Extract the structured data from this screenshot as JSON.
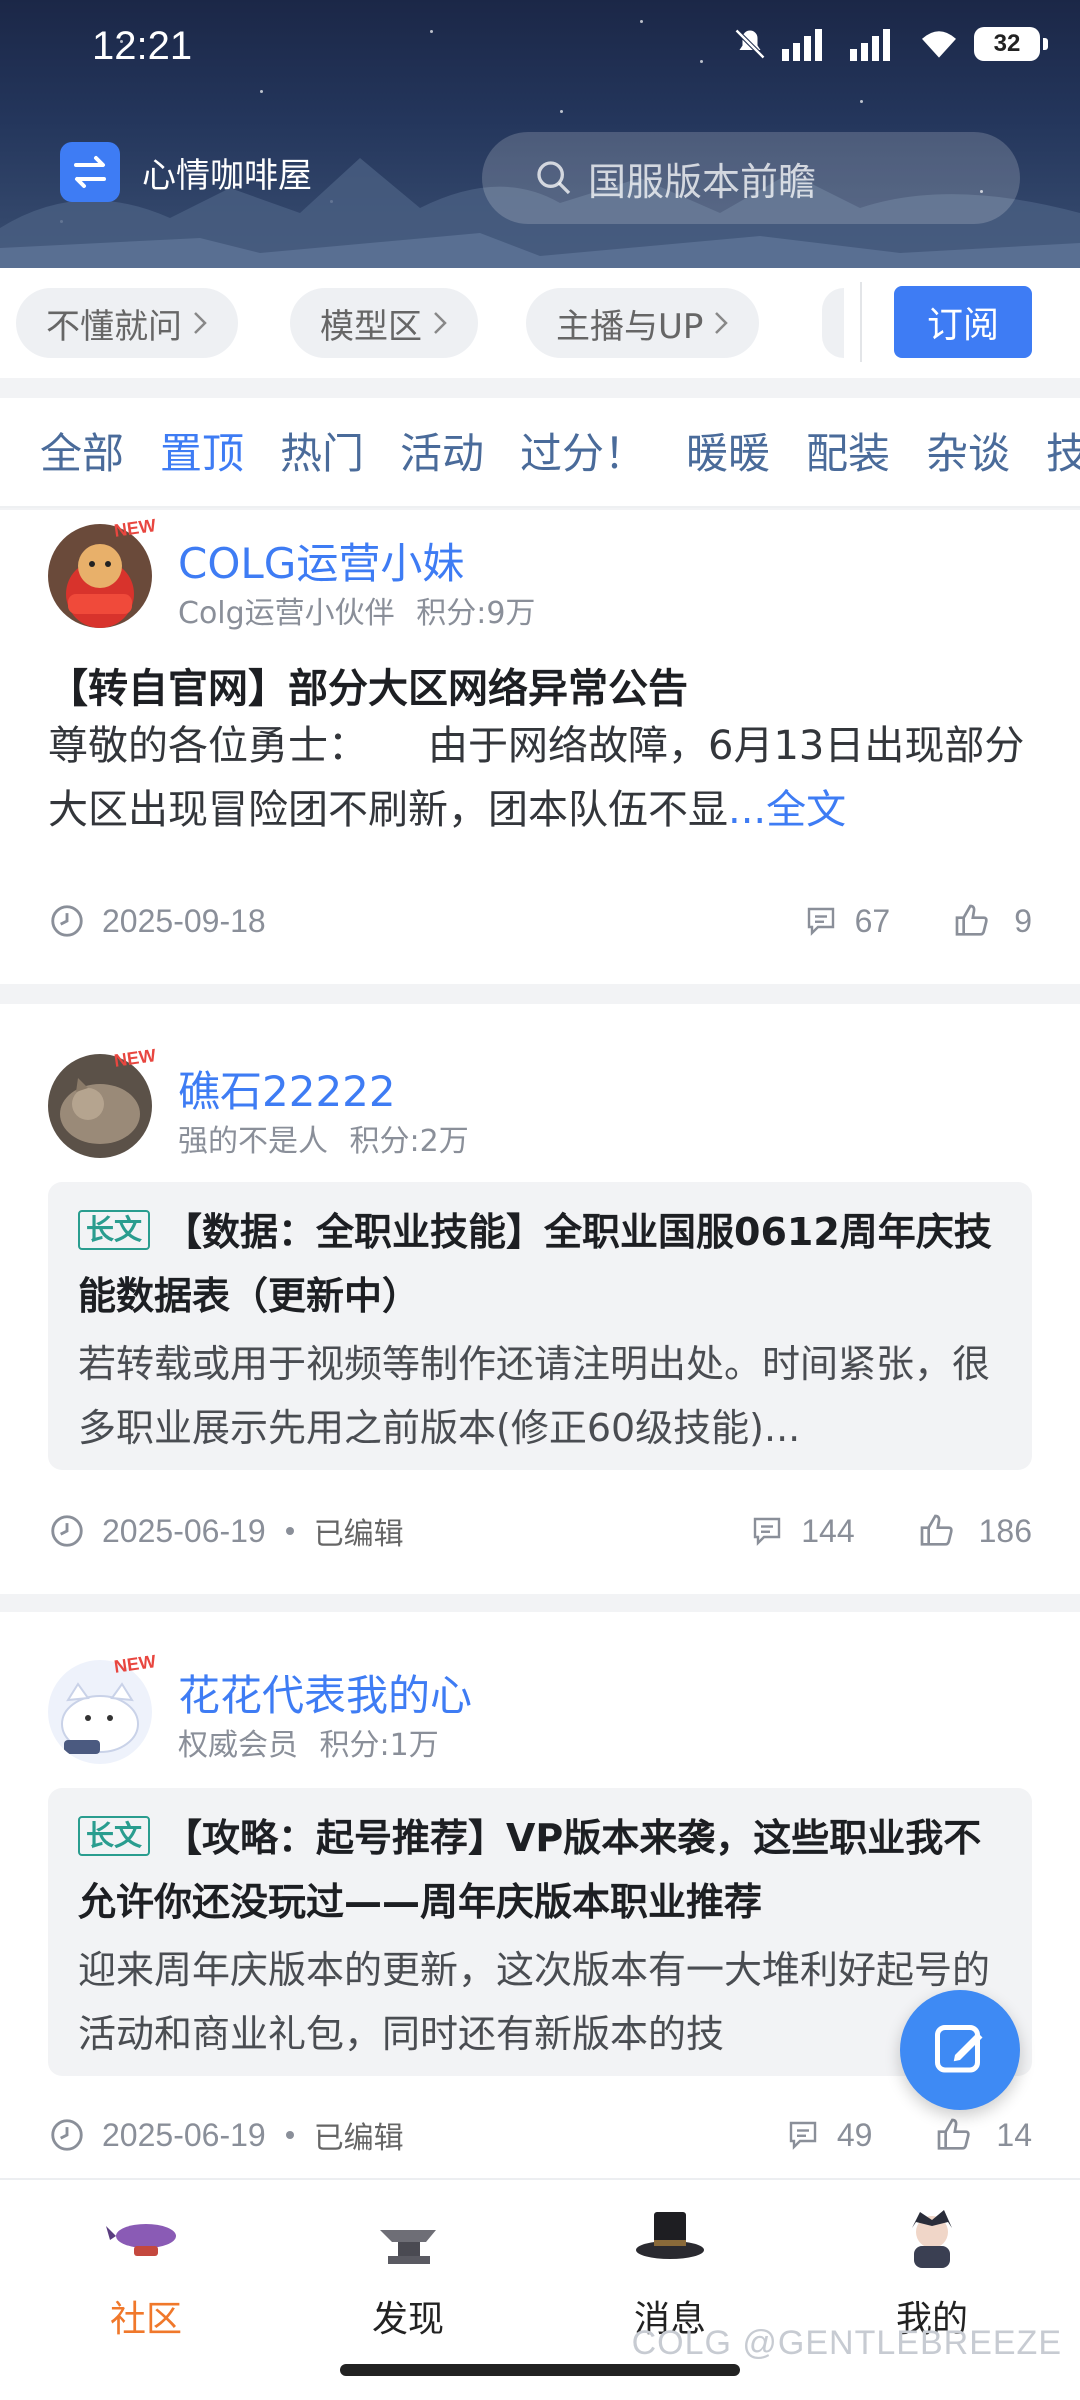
{
  "status_bar": {
    "time": "12:21",
    "battery": "32"
  },
  "header": {
    "forum_name": "心情咖啡屋",
    "search_placeholder": "国服版本前瞻"
  },
  "subforums": {
    "chips": [
      "不懂就问",
      "模型区",
      "主播与UP"
    ],
    "subscribe_label": "订阅"
  },
  "filter_tabs": [
    "全部",
    "置顶",
    "热门",
    "活动",
    "过分！",
    "暖暖",
    "配装",
    "杂谈",
    "技"
  ],
  "active_filter_tab": "置顶",
  "posts": [
    {
      "author": "COLG运营小妹",
      "new_tag": "NEW",
      "role": "Colg运营小伙伴",
      "points": "积分:9万",
      "title": "【转自官网】部分大区网络异常公告",
      "excerpt": "尊敬的各位勇士：　　由于网络故障，6月13日出现部分大区出现冒险团不刷新，团本队伍不显",
      "more_label": "...全文",
      "date": "2025-09-18",
      "edited": "",
      "comments": "67",
      "likes": "9"
    },
    {
      "author": "礁石22222",
      "new_tag": "NEW",
      "role": "强的不是人",
      "points": "积分:2万",
      "badge": "长文",
      "quote_title": "【数据：全职业技能】全职业国服0612周年庆技能数据表（更新中）",
      "quote_body": "若转载或用于视频等制作还请注明出处。时间紧张，很多职业展示先用之前版本(修正60级技能)...",
      "date": "2025-06-19",
      "edited": "已编辑",
      "comments": "144",
      "likes": "186"
    },
    {
      "author": "花花代表我的心",
      "new_tag": "NEW",
      "role": "权威会员",
      "points": "积分:1万",
      "badge": "长文",
      "quote_title": "【攻略：起号推荐】VP版本来袭，这些职业我不允许你还没玩过——周年庆版本职业推荐",
      "quote_body": "迎来周年庆版本的更新，这次版本有一大堆利好起号的活动和商业礼包，同时还有新版本的技",
      "date": "2025-06-19",
      "edited": "已编辑",
      "comments": "49",
      "likes": "14"
    }
  ],
  "bottom_nav": [
    {
      "label": "社区",
      "active": true
    },
    {
      "label": "发现",
      "active": false
    },
    {
      "label": "消息",
      "active": false
    },
    {
      "label": "我的",
      "active": false
    }
  ],
  "watermark": "COLG @GENTLEBREEZE",
  "colors": {
    "accent": "#3e7cf4",
    "nav_active": "#f0782b",
    "badge": "#2a9d8f"
  }
}
